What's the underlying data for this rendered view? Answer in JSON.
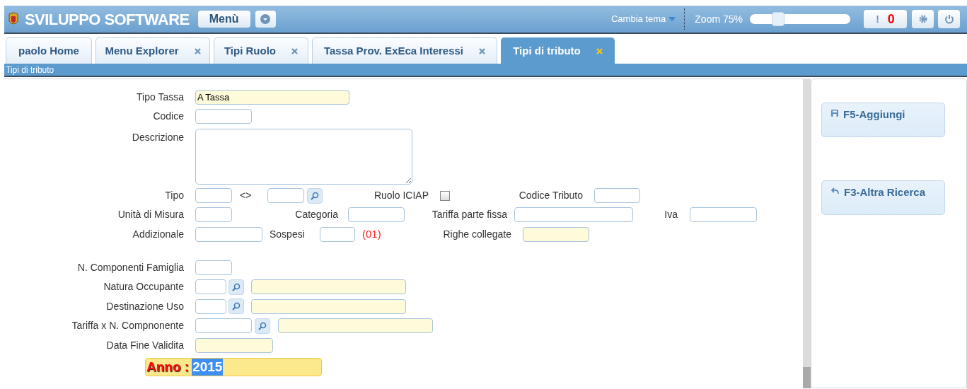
{
  "header": {
    "title": "SVILUPPO SOFTWARE",
    "menu_button": "Menù",
    "theme_menu": "Cambia tema",
    "zoom_label": "Zoom 75%",
    "zoom_slider": {
      "level": 0.28
    },
    "alerts_button": {
      "icon": "!",
      "count": "0"
    }
  },
  "tabs": [
    {
      "label": "paolo Home",
      "closable": false,
      "selected": false
    },
    {
      "label": "Menu Explorer",
      "closable": true,
      "selected": false
    },
    {
      "label": "Tipi Ruolo",
      "closable": true,
      "selected": false
    },
    {
      "label": "Tassa Prov. ExEca Interessi",
      "closable": true,
      "selected": false
    },
    {
      "label": "Tipi di tributo",
      "closable": true,
      "selected": true
    }
  ],
  "breadcrumb": "Tipi di tributo",
  "form": {
    "rows": [
      {
        "label": "Tipo Tassa",
        "items": [
          {
            "kind": "input",
            "value": "A Tassa",
            "highlighted": true
          }
        ]
      },
      {
        "label": "Codice",
        "items": [
          {
            "kind": "input",
            "highlighted": false
          }
        ]
      },
      {
        "label": "Descrizione",
        "items": [
          {
            "kind": "textarea",
            "highlighted": false
          }
        ]
      },
      {
        "label": "Tipo",
        "items": [
          {
            "kind": "input",
            "highlighted": false
          },
          {
            "kind": "text",
            "text": "<>"
          },
          {
            "kind": "input",
            "highlighted": false
          },
          {
            "kind": "lookup"
          },
          {
            "kind": "text",
            "text": "Ruolo ICIAP"
          },
          {
            "kind": "checkbox",
            "checked": false
          },
          {
            "kind": "text",
            "text": "Codice Tributo"
          },
          {
            "kind": "input",
            "highlighted": false
          }
        ]
      },
      {
        "label": "Unità di Misura",
        "items": [
          {
            "kind": "input",
            "highlighted": false
          },
          {
            "kind": "text",
            "text": "Categoria"
          },
          {
            "kind": "input",
            "highlighted": false
          },
          {
            "kind": "text",
            "text": "Tariffa parte fissa"
          },
          {
            "kind": "input",
            "highlighted": false
          },
          {
            "kind": "text",
            "text": "Iva"
          },
          {
            "kind": "input",
            "highlighted": false
          }
        ]
      },
      {
        "label": "Addizionale",
        "items": [
          {
            "kind": "input",
            "highlighted": false
          },
          {
            "kind": "text",
            "text": "Sospesi"
          },
          {
            "kind": "input",
            "highlighted": false
          },
          {
            "kind": "note",
            "text": "(01)"
          },
          {
            "kind": "text",
            "text": "Righe collegate"
          },
          {
            "kind": "input",
            "highlighted": true
          }
        ]
      },
      {
        "label": "N. Componenti Famiglia",
        "items": [
          {
            "kind": "input",
            "highlighted": false
          }
        ]
      },
      {
        "label": "Natura Occupante",
        "items": [
          {
            "kind": "input",
            "highlighted": false
          },
          {
            "kind": "lookup"
          },
          {
            "kind": "input",
            "highlighted": true
          }
        ]
      },
      {
        "label": "Destinazione Uso",
        "items": [
          {
            "kind": "input",
            "highlighted": false
          },
          {
            "kind": "lookup"
          },
          {
            "kind": "input",
            "highlighted": true
          }
        ]
      },
      {
        "label": "Tariffa x N. Compnonente",
        "items": [
          {
            "kind": "input",
            "highlighted": false
          },
          {
            "kind": "lookup"
          },
          {
            "kind": "input",
            "highlighted": true
          }
        ]
      },
      {
        "label": "Data Fine Validita",
        "items": [
          {
            "kind": "input",
            "highlighted": true
          }
        ]
      }
    ]
  },
  "year": {
    "label": "Anno :",
    "value": "2015"
  },
  "actions": [
    {
      "label": "F5-Aggiungi",
      "kind": "save"
    },
    {
      "label": "F3-Altra Ricerca",
      "kind": "back"
    }
  ]
}
